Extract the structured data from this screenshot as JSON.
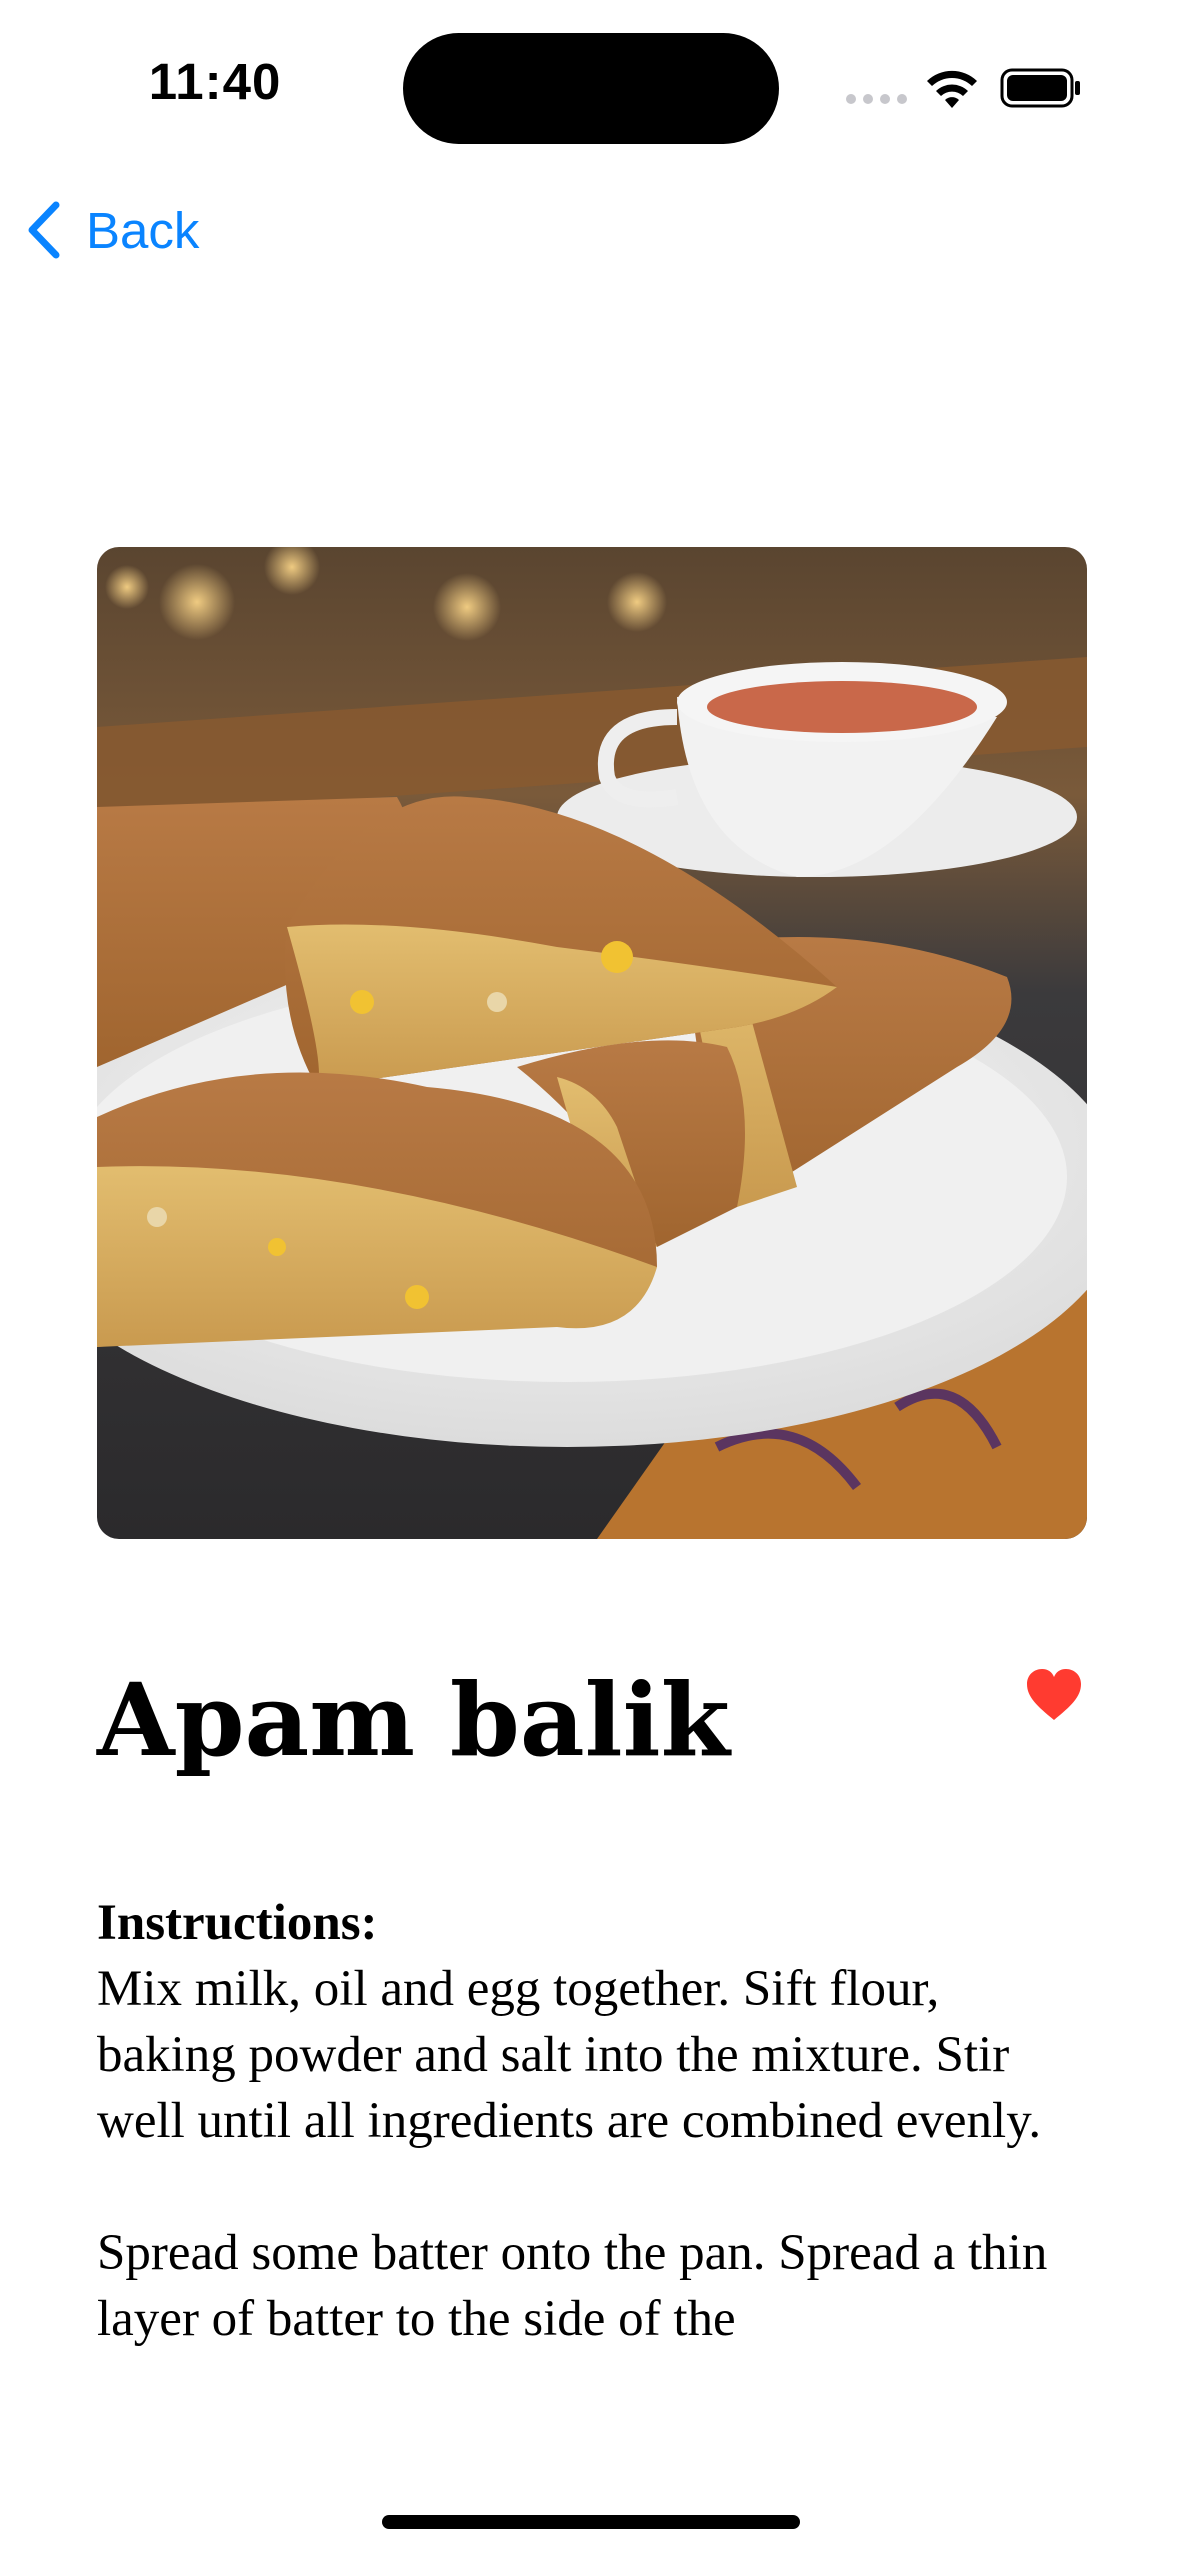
{
  "status_bar": {
    "time": "11:40"
  },
  "nav": {
    "back_label": "Back"
  },
  "recipe": {
    "image_icon": "food-photo",
    "title": "Apam balik",
    "is_favorite": true,
    "instructions_heading": "Instructions:",
    "instructions_text": "Mix milk, oil and egg together. Sift flour, baking powder and salt into the mixture. Stir well until all ingredients are combined evenly.\n\nSpread some batter onto the pan. Spread a thin layer of batter to the side of the"
  },
  "colors": {
    "accent": "#0a84ff",
    "favorite": "#ff3b30",
    "background": "#ffffff"
  }
}
